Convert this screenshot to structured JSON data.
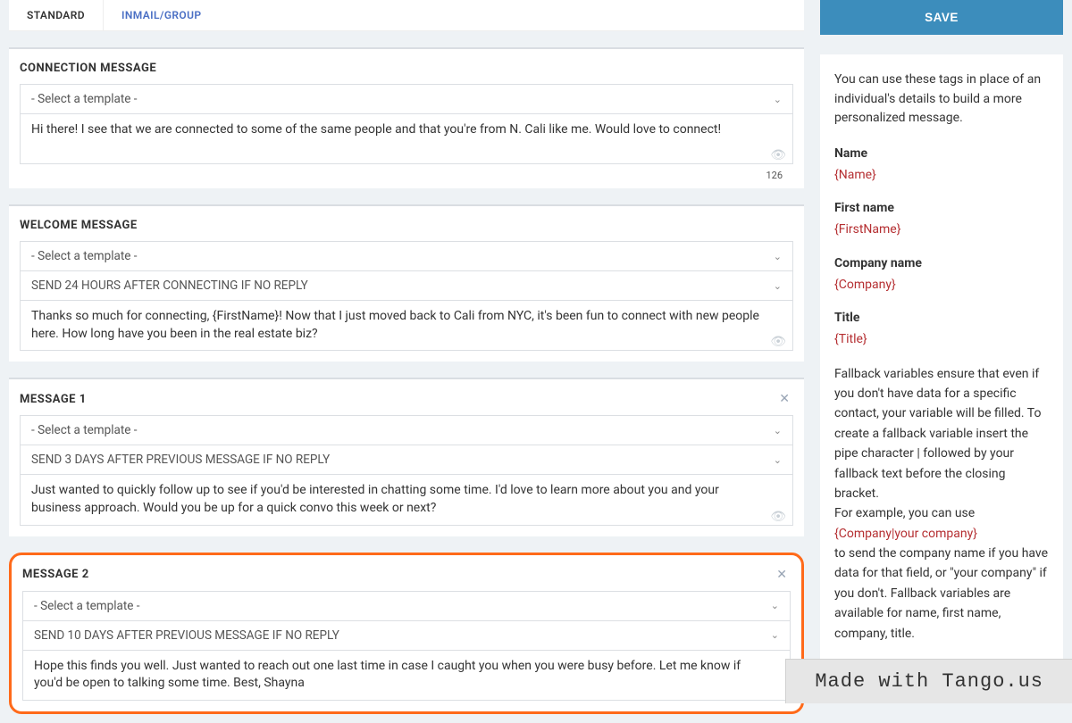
{
  "tabs": {
    "standard": "STANDARD",
    "inmail": "INMAIL/GROUP"
  },
  "sections": {
    "connection": {
      "title": "CONNECTION MESSAGE",
      "template_placeholder": "- Select a template -",
      "body": "Hi there! I see that we are connected to some of the same people and that you're from N. Cali like me. Would love to connect!",
      "counter": "126"
    },
    "welcome": {
      "title": "WELCOME MESSAGE",
      "template_placeholder": "- Select a template -",
      "timing": "SEND 24 HOURS AFTER CONNECTING IF NO REPLY",
      "body": "Thanks so much for connecting, {FirstName}! Now that I just moved back to Cali from NYC, it's been fun to connect with new people here. How long have you been in the real estate biz?"
    },
    "msg1": {
      "title": "MESSAGE 1",
      "template_placeholder": "- Select a template -",
      "timing": "SEND 3 DAYS AFTER PREVIOUS MESSAGE IF NO REPLY",
      "body": "Just wanted to quickly follow up to see if you'd be interested in chatting some time. I'd love to learn more about you and your business approach. Would you be up for a quick convo this week or next?"
    },
    "msg2": {
      "title": "MESSAGE 2",
      "template_placeholder": "- Select a template -",
      "timing": "SEND 10 DAYS AFTER PREVIOUS MESSAGE IF NO REPLY",
      "body": "Hope this finds you well. Just wanted to reach out one last time in case I caught you when you were busy before. Let me know if you'd be open to talking some time. Best, Shayna"
    }
  },
  "sidebar": {
    "save_label": "SAVE",
    "intro": "You can use these tags in place of an individual's details to build a more personalized message.",
    "tags": {
      "name": {
        "label": "Name",
        "token": "{Name}"
      },
      "firstname": {
        "label": "First name",
        "token": "{FirstName}"
      },
      "company": {
        "label": "Company name",
        "token": "{Company}"
      },
      "title": {
        "label": "Title",
        "token": "{Title}"
      }
    },
    "fallback": {
      "p1": "Fallback variables ensure that even if you don't have data for a specific contact, your variable will be filled. To create a fallback variable insert the pipe character | followed by your fallback text before the closing bracket.",
      "p2a": "For example, you can use",
      "p2token": "{Company|your company}",
      "p2b": "to send the company name if you have data for that field, or \"your company\" if you don't. Fallback variables are available for name, first name, company, title."
    }
  },
  "watermark": "Made with Tango.us"
}
